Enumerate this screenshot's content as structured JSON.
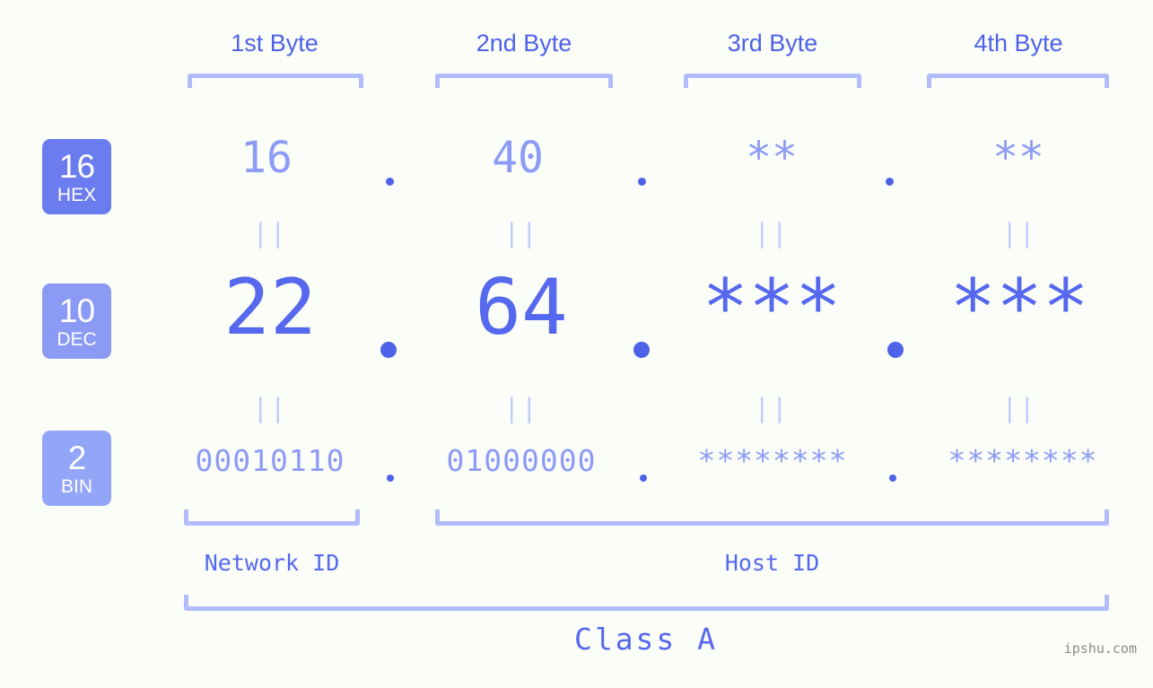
{
  "page": {
    "background_color": "#fbfdf8",
    "accent_strong": "#4e62e8",
    "accent_mid": "#5568ee",
    "accent_light": "#8c9bf5",
    "accent_pale": "#b3bcfb",
    "watermark": "ipshu.com"
  },
  "byte_headers": [
    {
      "label": "1st Byte"
    },
    {
      "label": "2nd Byte"
    },
    {
      "label": "3rd Byte"
    },
    {
      "label": "4th Byte"
    }
  ],
  "bases": [
    {
      "number": "16",
      "name": "HEX",
      "color": "#6b7cef"
    },
    {
      "number": "10",
      "name": "DEC",
      "color": "#8b9af5"
    },
    {
      "number": "2",
      "name": "BIN",
      "color": "#93a5f7"
    }
  ],
  "rows": {
    "hex": {
      "values": [
        "16",
        "40",
        "**",
        "**"
      ]
    },
    "dec": {
      "values": [
        "22",
        "64",
        "***",
        "***"
      ]
    },
    "bin": {
      "values": [
        "00010110",
        "01000000",
        "********",
        "********"
      ]
    }
  },
  "separators": {
    "dot": ".",
    "equals_mark": "||"
  },
  "id_sections": [
    {
      "label": "Network ID"
    },
    {
      "label": "Host ID"
    }
  ],
  "class": {
    "label": "Class A"
  }
}
